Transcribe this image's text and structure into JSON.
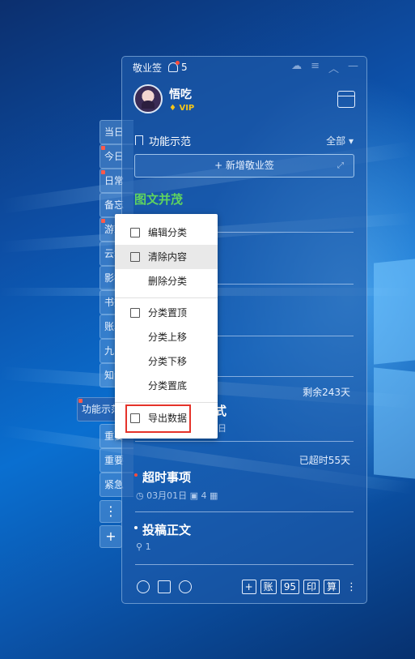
{
  "desktop": {
    "accent_color": "#0a6fd0"
  },
  "side_tabs": [
    {
      "label": "当日",
      "flag": false
    },
    {
      "label": "今日",
      "flag": true
    },
    {
      "label": "日常",
      "flag": true
    },
    {
      "label": "备忘",
      "flag": false
    },
    {
      "label": "游戏",
      "flag": true
    },
    {
      "label": "云笔",
      "flag": false
    },
    {
      "label": "影视",
      "flag": false
    },
    {
      "label": "书签",
      "flag": false
    },
    {
      "label": "账单",
      "flag": false
    },
    {
      "label": "九宫",
      "flag": false
    },
    {
      "label": "知识",
      "flag": false
    }
  ],
  "side_tabs_after": [
    {
      "label": "重要",
      "flag": false
    },
    {
      "label": "重要",
      "flag": false
    },
    {
      "label": "紧急",
      "flag": false
    }
  ],
  "active_tab": {
    "label": "功能示范"
  },
  "side_more_label": "⋮",
  "side_add_label": "+",
  "titlebar": {
    "title": "敬业签",
    "notification_count": "5",
    "icons": [
      "cloud-icon",
      "menu-icon",
      "collapse-icon",
      "minimize-icon"
    ]
  },
  "user": {
    "name": "悟吃",
    "vip": "VIP"
  },
  "category": {
    "title": "功能示范",
    "filter": "全部 ▾"
  },
  "add_button": {
    "label": "+ 新增敬业签"
  },
  "notes": [
    {
      "title": "图文并茂",
      "title_color": "#5fd35f"
    },
    {
      "title": "",
      "due": "剩余243天"
    },
    {
      "title": "超时事项",
      "due": "已超时55天",
      "date": "03月01日",
      "images": "4"
    },
    {
      "title": "投稿正文",
      "attachments": "1"
    }
  ],
  "partial_text": {
    "fragment1": "式",
    "fragment2": "日"
  },
  "footer": {
    "buttons": [
      "+",
      "账",
      "95",
      "印",
      "算"
    ],
    "more": "⋮"
  },
  "context_menu": {
    "items": [
      {
        "label": "编辑分类",
        "icon": "edit-icon"
      },
      {
        "label": "清除内容",
        "icon": "trash-icon",
        "highlighted": true
      },
      {
        "label": "删除分类",
        "icon": ""
      },
      {
        "label": "分类置顶",
        "icon": "pin-top-icon"
      },
      {
        "label": "分类上移",
        "icon": ""
      },
      {
        "label": "分类下移",
        "icon": ""
      },
      {
        "label": "分类置底",
        "icon": ""
      },
      {
        "label": "导出数据",
        "icon": "export-icon",
        "boxed": true
      }
    ],
    "highlight_color": "#e5332a"
  }
}
